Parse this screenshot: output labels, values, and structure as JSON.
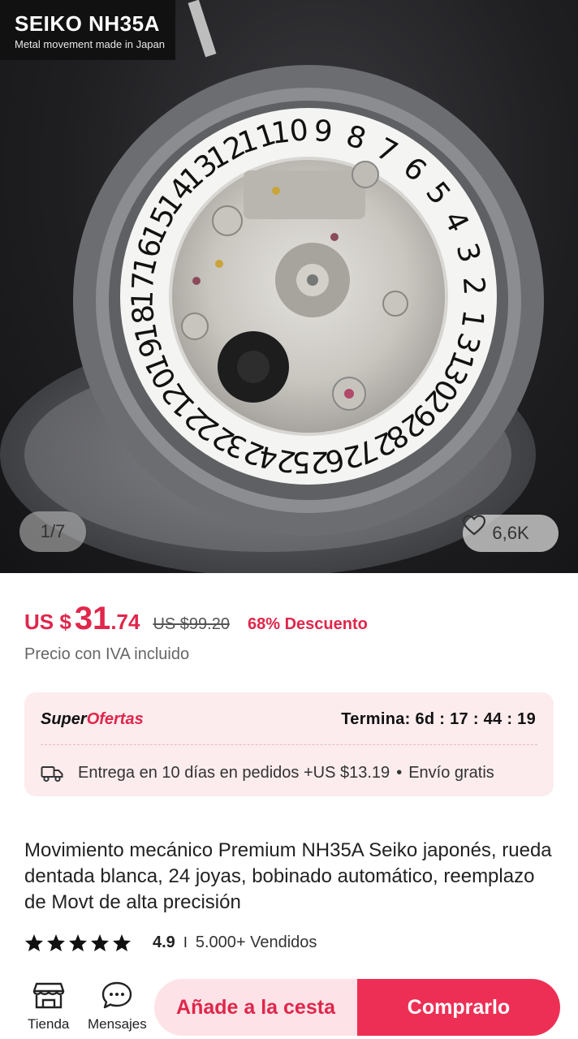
{
  "hero": {
    "brand_title": "SEIKO NH35A",
    "brand_subtitle": "Metal movement made in Japan",
    "image_counter": "1/7",
    "favorites": "6,6K",
    "dial_numbers": [
      "1",
      "2",
      "3",
      "4",
      "5",
      "6",
      "7",
      "8",
      "9",
      "10",
      "11",
      "12",
      "13",
      "14",
      "15",
      "16",
      "17",
      "18",
      "19",
      "20",
      "21",
      "22",
      "23",
      "24",
      "25",
      "26",
      "27",
      "28",
      "29",
      "30",
      "31"
    ]
  },
  "price": {
    "currency": "US $",
    "integer": "31",
    "decimal": ".74",
    "original": "US $99.20",
    "discount": "68% Descuento",
    "vat_note": "Precio con IVA incluido"
  },
  "offer": {
    "label_super": "Super",
    "label_ofertas": "Ofertas",
    "ends": "Termina: 6d : 17 : 44 : 19",
    "delivery": "Entrega en 10 días en pedidos +US $13.19",
    "shipping": "Envío gratis"
  },
  "product": {
    "title": "Movimiento mecánico Premium NH35A Seiko japonés, rueda dentada blanca, 24 joyas, bobinado automático, reemplazo de Movt de alta precisión",
    "rating": "4.9",
    "rating_stars": 5,
    "sold": "5.000+ Vendidos"
  },
  "bottom_bar": {
    "store_label": "Tienda",
    "messages_label": "Mensajes",
    "add_to_cart": "Añade a la cesta",
    "buy_now": "Comprarlo"
  },
  "colors": {
    "accent": "#e0264b",
    "buy_button": "#ee2f55",
    "cart_button_bg": "#fde3e7",
    "offer_bg": "#fcecee"
  }
}
